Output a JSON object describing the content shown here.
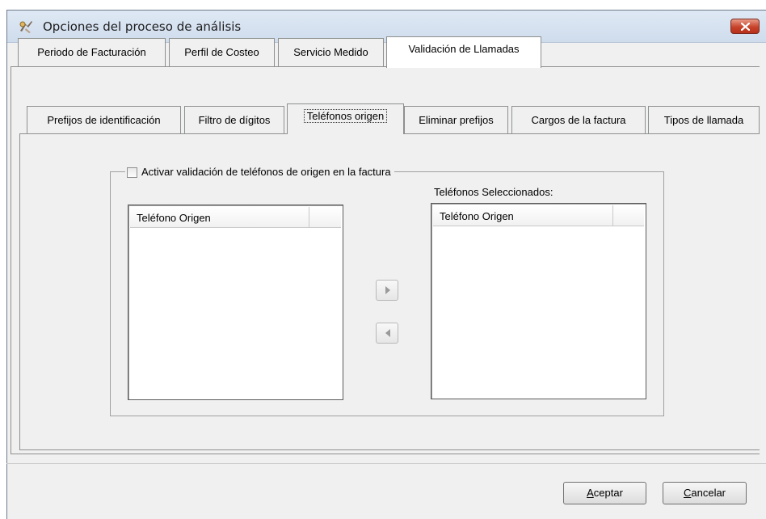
{
  "window": {
    "title": "Opciones del proceso de análisis",
    "close_icon": "close-x-icon",
    "app_icon": "process-icon"
  },
  "outer_tabs": [
    {
      "label": "Periodo de Facturación",
      "active": false
    },
    {
      "label": "Perfil de Costeo",
      "active": false
    },
    {
      "label": "Servicio Medido",
      "active": false
    },
    {
      "label": "Validación de Llamadas",
      "active": true
    }
  ],
  "inner_tabs": [
    {
      "label": "Prefijos de identificación",
      "active": false
    },
    {
      "label": "Filtro de dígitos",
      "active": false
    },
    {
      "label": "Teléfonos origen",
      "active": true
    },
    {
      "label": "Eliminar prefijos",
      "active": false
    },
    {
      "label": "Cargos de la factura",
      "active": false
    },
    {
      "label": "Tipos de llamada",
      "active": false
    }
  ],
  "group": {
    "checkbox_label": "Activar validación de teléfonos de origen en la factura",
    "checked": false,
    "selected_label": "Teléfonos Seleccionados:",
    "left_list": {
      "column": "Teléfono Origen",
      "rows": []
    },
    "right_list": {
      "column": "Teléfono Origen",
      "rows": []
    },
    "add_icon": "arrow-right-icon",
    "remove_icon": "arrow-left-icon"
  },
  "footer": {
    "accept_label": "Aceptar",
    "accept_mnemonic": "A",
    "accept_rest": "ceptar",
    "cancel_label": "Cancelar",
    "cancel_mnemonic": "C",
    "cancel_rest": "ancelar"
  }
}
